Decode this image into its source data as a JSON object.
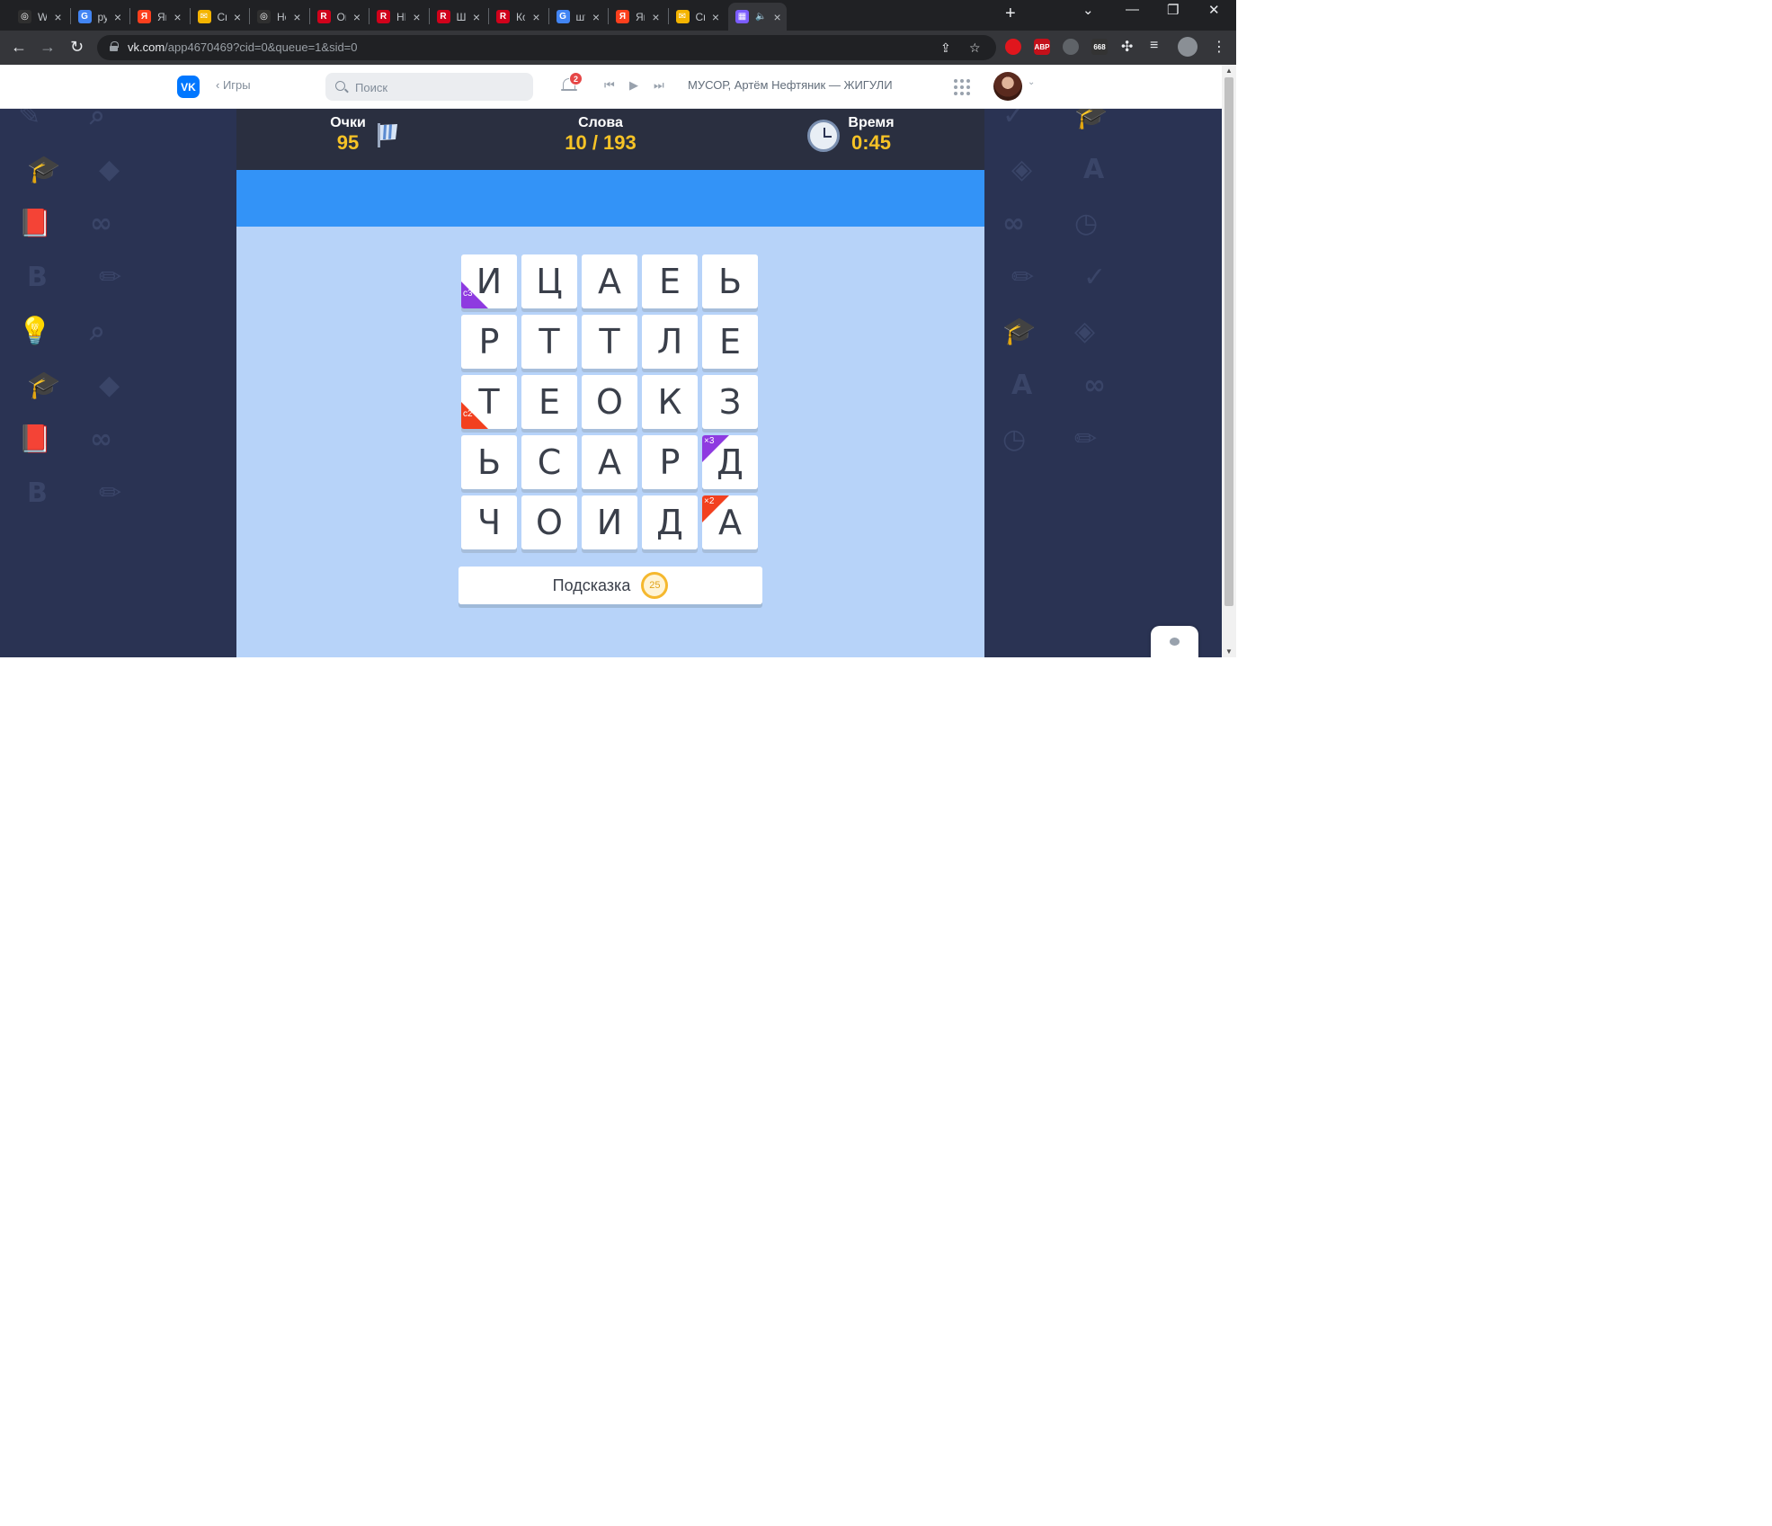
{
  "browser": {
    "tabs": [
      {
        "title": "Wh",
        "fav_color": "#2f2f2f",
        "fav_char": "◎"
      },
      {
        "title": "руб",
        "fav_color": "#4285f4",
        "fav_char": "G"
      },
      {
        "title": "Янд",
        "fav_color": "#fc3f1d",
        "fav_char": "Я"
      },
      {
        "title": "Спа",
        "fav_color": "#f4b400",
        "fav_char": "✉"
      },
      {
        "title": "Ho",
        "fav_color": "#2f2f2f",
        "fav_char": "◎"
      },
      {
        "title": "Опс",
        "fav_color": "#d0021b",
        "fav_char": "R"
      },
      {
        "title": "НЕР",
        "fav_color": "#d0021b",
        "fav_char": "R"
      },
      {
        "title": "Шт",
        "fav_color": "#d0021b",
        "fav_char": "R"
      },
      {
        "title": "Кор",
        "fav_color": "#d0021b",
        "fav_char": "R"
      },
      {
        "title": "шту",
        "fav_color": "#4285f4",
        "fav_char": "G"
      },
      {
        "title": "Янд",
        "fav_color": "#fc3f1d",
        "fav_char": "Я"
      },
      {
        "title": "Спа",
        "fav_color": "#f4b400",
        "fav_char": "✉"
      },
      {
        "title": "",
        "fav_color": "#7b5cff",
        "fav_char": "▦"
      }
    ],
    "url_host": "vk.com",
    "url_path": "/app4670469?cid=0&queue=1&sid=0",
    "extensions": [
      {
        "icon": "opera-icon",
        "color": "#e0161d",
        "text": ""
      },
      {
        "icon": "adblock-icon",
        "color": "#c4101a",
        "text": "ABP"
      },
      {
        "icon": "globe-icon",
        "color": "#5f6368",
        "text": ""
      },
      {
        "icon": "counter-icon",
        "color": "#333333",
        "text": "668"
      }
    ]
  },
  "vk": {
    "back_label": "Игры",
    "search_placeholder": "Поиск",
    "notifications_count": "2",
    "now_playing": "МУСОР, Артём Нефтяник — ЖИГУЛИ"
  },
  "game": {
    "score_label": "Очки",
    "score_value": "95",
    "words_label": "Слова",
    "words_value": "10 / 193",
    "time_label": "Время",
    "time_value": "0:45",
    "grid": [
      [
        "И",
        "Ц",
        "А",
        "Е",
        "Ь"
      ],
      [
        "Р",
        "Т",
        "Т",
        "Л",
        "Е"
      ],
      [
        "Т",
        "Е",
        "О",
        "К",
        "З"
      ],
      [
        "Ь",
        "С",
        "А",
        "Р",
        "Д"
      ],
      [
        "Ч",
        "О",
        "И",
        "Д",
        "А"
      ]
    ],
    "bonuses": [
      {
        "row": 0,
        "col": 0,
        "text": "с3",
        "corner": "bottom-left",
        "color": "#8e3ae0"
      },
      {
        "row": 2,
        "col": 0,
        "text": "с2",
        "corner": "bottom-left",
        "color": "#f2401f"
      },
      {
        "row": 3,
        "col": 4,
        "text": "×3",
        "corner": "top-left",
        "color": "#8e3ae0"
      },
      {
        "row": 4,
        "col": 4,
        "text": "×2",
        "corner": "top-left",
        "color": "#f2401f"
      }
    ],
    "hint_label": "Подсказка",
    "hint_cost": "25"
  },
  "colors": {
    "background": "#2a3353",
    "game_area": "#b7d3f9",
    "banner": "#3393f7",
    "stat_value": "#f7c326"
  }
}
